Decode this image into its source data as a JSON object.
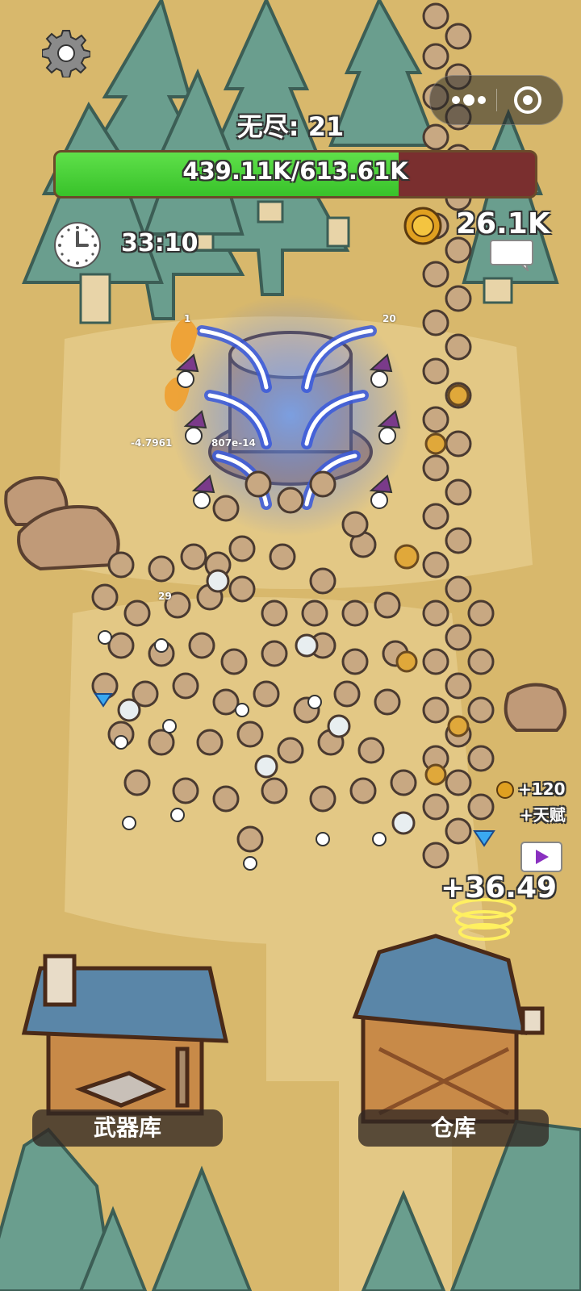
{
  "hud": {
    "mode_label": "无尽: 21",
    "boss_hp": {
      "current": 439.11,
      "max": 613.61,
      "unit": "K",
      "text": "439.11K/613.61K"
    },
    "timer": "33:10",
    "coins": "26.1K"
  },
  "icons": {
    "settings": "gear-icon",
    "more": "more-dots-icon",
    "close": "record-circle-icon",
    "clock": "clock-icon",
    "coin": "coin-icon",
    "chat": "chat-bubble-icon",
    "video": "video-play-icon",
    "gem": "diamond-icon"
  },
  "floating": {
    "damage_left": "-4.7961",
    "damage_tail": "807e-14",
    "damage_small": "29",
    "top_left_label": "1",
    "top_right_label": "20",
    "bonus_coins": "+120",
    "bonus_talent": "+天赋",
    "gain": "+36.49"
  },
  "buildings": {
    "armory_label": "武器库",
    "warehouse_label": "仓库"
  },
  "colors": {
    "hp_fill": "#38c22a",
    "hp_empty": "#7a2f2f",
    "ground": "#d8b86c",
    "tree": "#6a9e8e"
  }
}
